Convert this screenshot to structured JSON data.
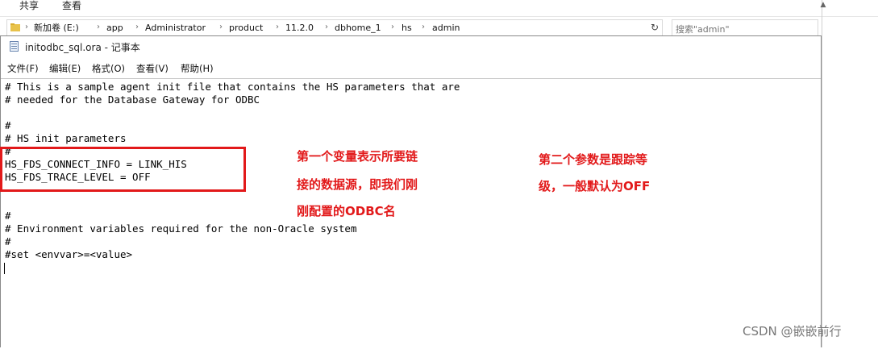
{
  "explorer": {
    "ribbon_tabs": [
      "共享",
      "查看"
    ],
    "breadcrumb": [
      "新加卷 (E:)",
      "app",
      "Administrator",
      "product",
      "11.2.0",
      "dbhome_1",
      "hs",
      "admin"
    ],
    "search_placeholder": "搜索\"admin\""
  },
  "notepad": {
    "title": "initodbc_sql.ora - 记事本",
    "menus": [
      "文件(F)",
      "编辑(E)",
      "格式(O)",
      "查看(V)",
      "帮助(H)"
    ],
    "lines": [
      "# This is a sample agent init file that contains the HS parameters that are",
      "# needed for the Database Gateway for ODBC",
      "",
      "#",
      "# HS init parameters",
      "#",
      "HS_FDS_CONNECT_INFO = LINK_HIS",
      "HS_FDS_TRACE_LEVEL = OFF",
      "",
      "",
      "#",
      "# Environment variables required for the non-Oracle system",
      "#",
      "#set <envvar>=<value>"
    ]
  },
  "annotations": {
    "note1": [
      "第一个变量表示所要链",
      "接的数据源，即我们刚",
      "刚配置的ODBC名"
    ],
    "note2": [
      "第二个参数是跟踪等",
      "级，一般默认为OFF"
    ],
    "color": "#e2191a"
  },
  "watermark": "CSDN @嵌嵌前行"
}
